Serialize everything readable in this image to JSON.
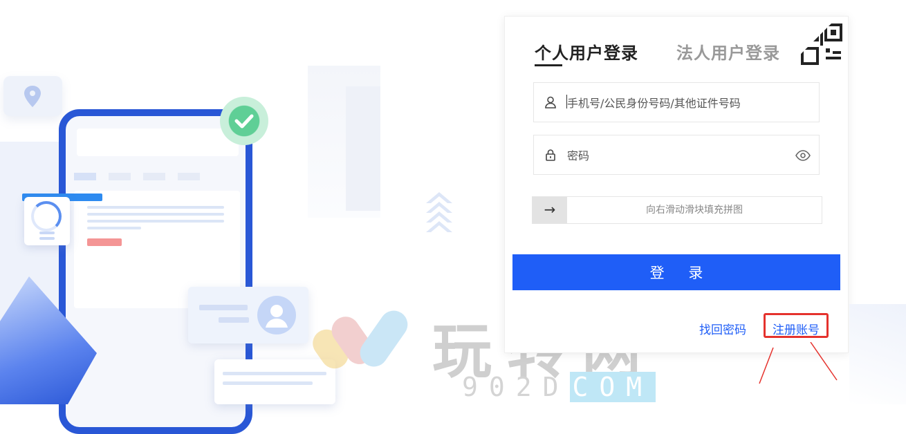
{
  "tabs": [
    {
      "label": "个人用户登录",
      "active": true
    },
    {
      "label": "法人用户登录",
      "active": false
    }
  ],
  "username": {
    "placeholder": "手机号/公民身份号码/其他证件号码",
    "value": ""
  },
  "password": {
    "placeholder": "密码",
    "value": ""
  },
  "slider": {
    "arrow": "→",
    "hint": "向右滑动滑块填充拼图"
  },
  "login_button": "登 录",
  "links": {
    "forgot": "找回密码",
    "register": "注册账号"
  },
  "watermark": {
    "title": "玩转网",
    "sub_prefix": "902D",
    "sub_highlight": "COM"
  },
  "icons": [
    "qr-code-icon",
    "user-icon",
    "lock-icon",
    "eye-icon",
    "location-pin-icon",
    "check-icon",
    "avatar-icon"
  ],
  "colors": {
    "primary": "#1f5ef7",
    "highlight": "#e5322d",
    "tab_active": "#222222",
    "tab_inactive": "#999999"
  }
}
